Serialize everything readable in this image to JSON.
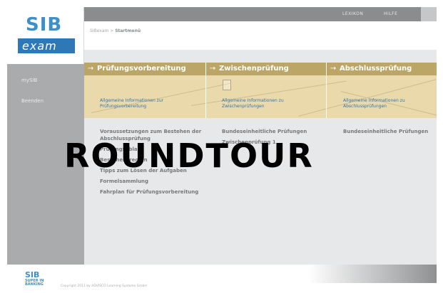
{
  "brand": {
    "logo_main": "SIB",
    "logo_sub": "exam"
  },
  "topnav": {
    "items": [
      "LEXIKON",
      "HILFE"
    ]
  },
  "breadcrumb": {
    "root": "SIBexam",
    "separator": ">",
    "current": "Startmenü"
  },
  "sidebar": {
    "items": [
      "mySIB",
      "Beenden"
    ]
  },
  "columns": [
    {
      "title": "Prüfungsvorbereitung",
      "link": "Allgemeine Informationen zur Prüfungsvorbereitung"
    },
    {
      "title": "Zwischenprüfung",
      "link": "Allgemeine Informationen zu Zwischenprüfungen"
    },
    {
      "title": "Abschlussprüfung",
      "link": "Allgemeine Informationen zu Abschlussprüfungen"
    }
  ],
  "col1_links": [
    "Voraussetzungen zum Bestehen der Abschlussprüfung",
    "Prüfungsablauf",
    "Bestehensregeln",
    "Tipps zum Lösen der Aufgaben",
    "Formelsammlung",
    "Fahrplan für Prüfungsvorbereitung"
  ],
  "col2_links": [
    "Bundeseinheitliche Prüfungen",
    "Zwischenprüfung 1"
  ],
  "col3_links": [
    "Bundeseinheitliche Prüfungen"
  ],
  "overlay": {
    "text": "ROUNDTOUR"
  },
  "footer": {
    "logo_main": "SIB",
    "logo_sub1": "SUPER IN",
    "logo_sub2": "BANKING",
    "copyright": "Copyright 2011 by ADVISCO Learning Systems GmbH"
  },
  "colors": {
    "accent": "#2f78b8",
    "header_gold": "#bba667",
    "band": "#ead9ab",
    "sidebar": "#a9abac",
    "link": "#2f75ab"
  }
}
